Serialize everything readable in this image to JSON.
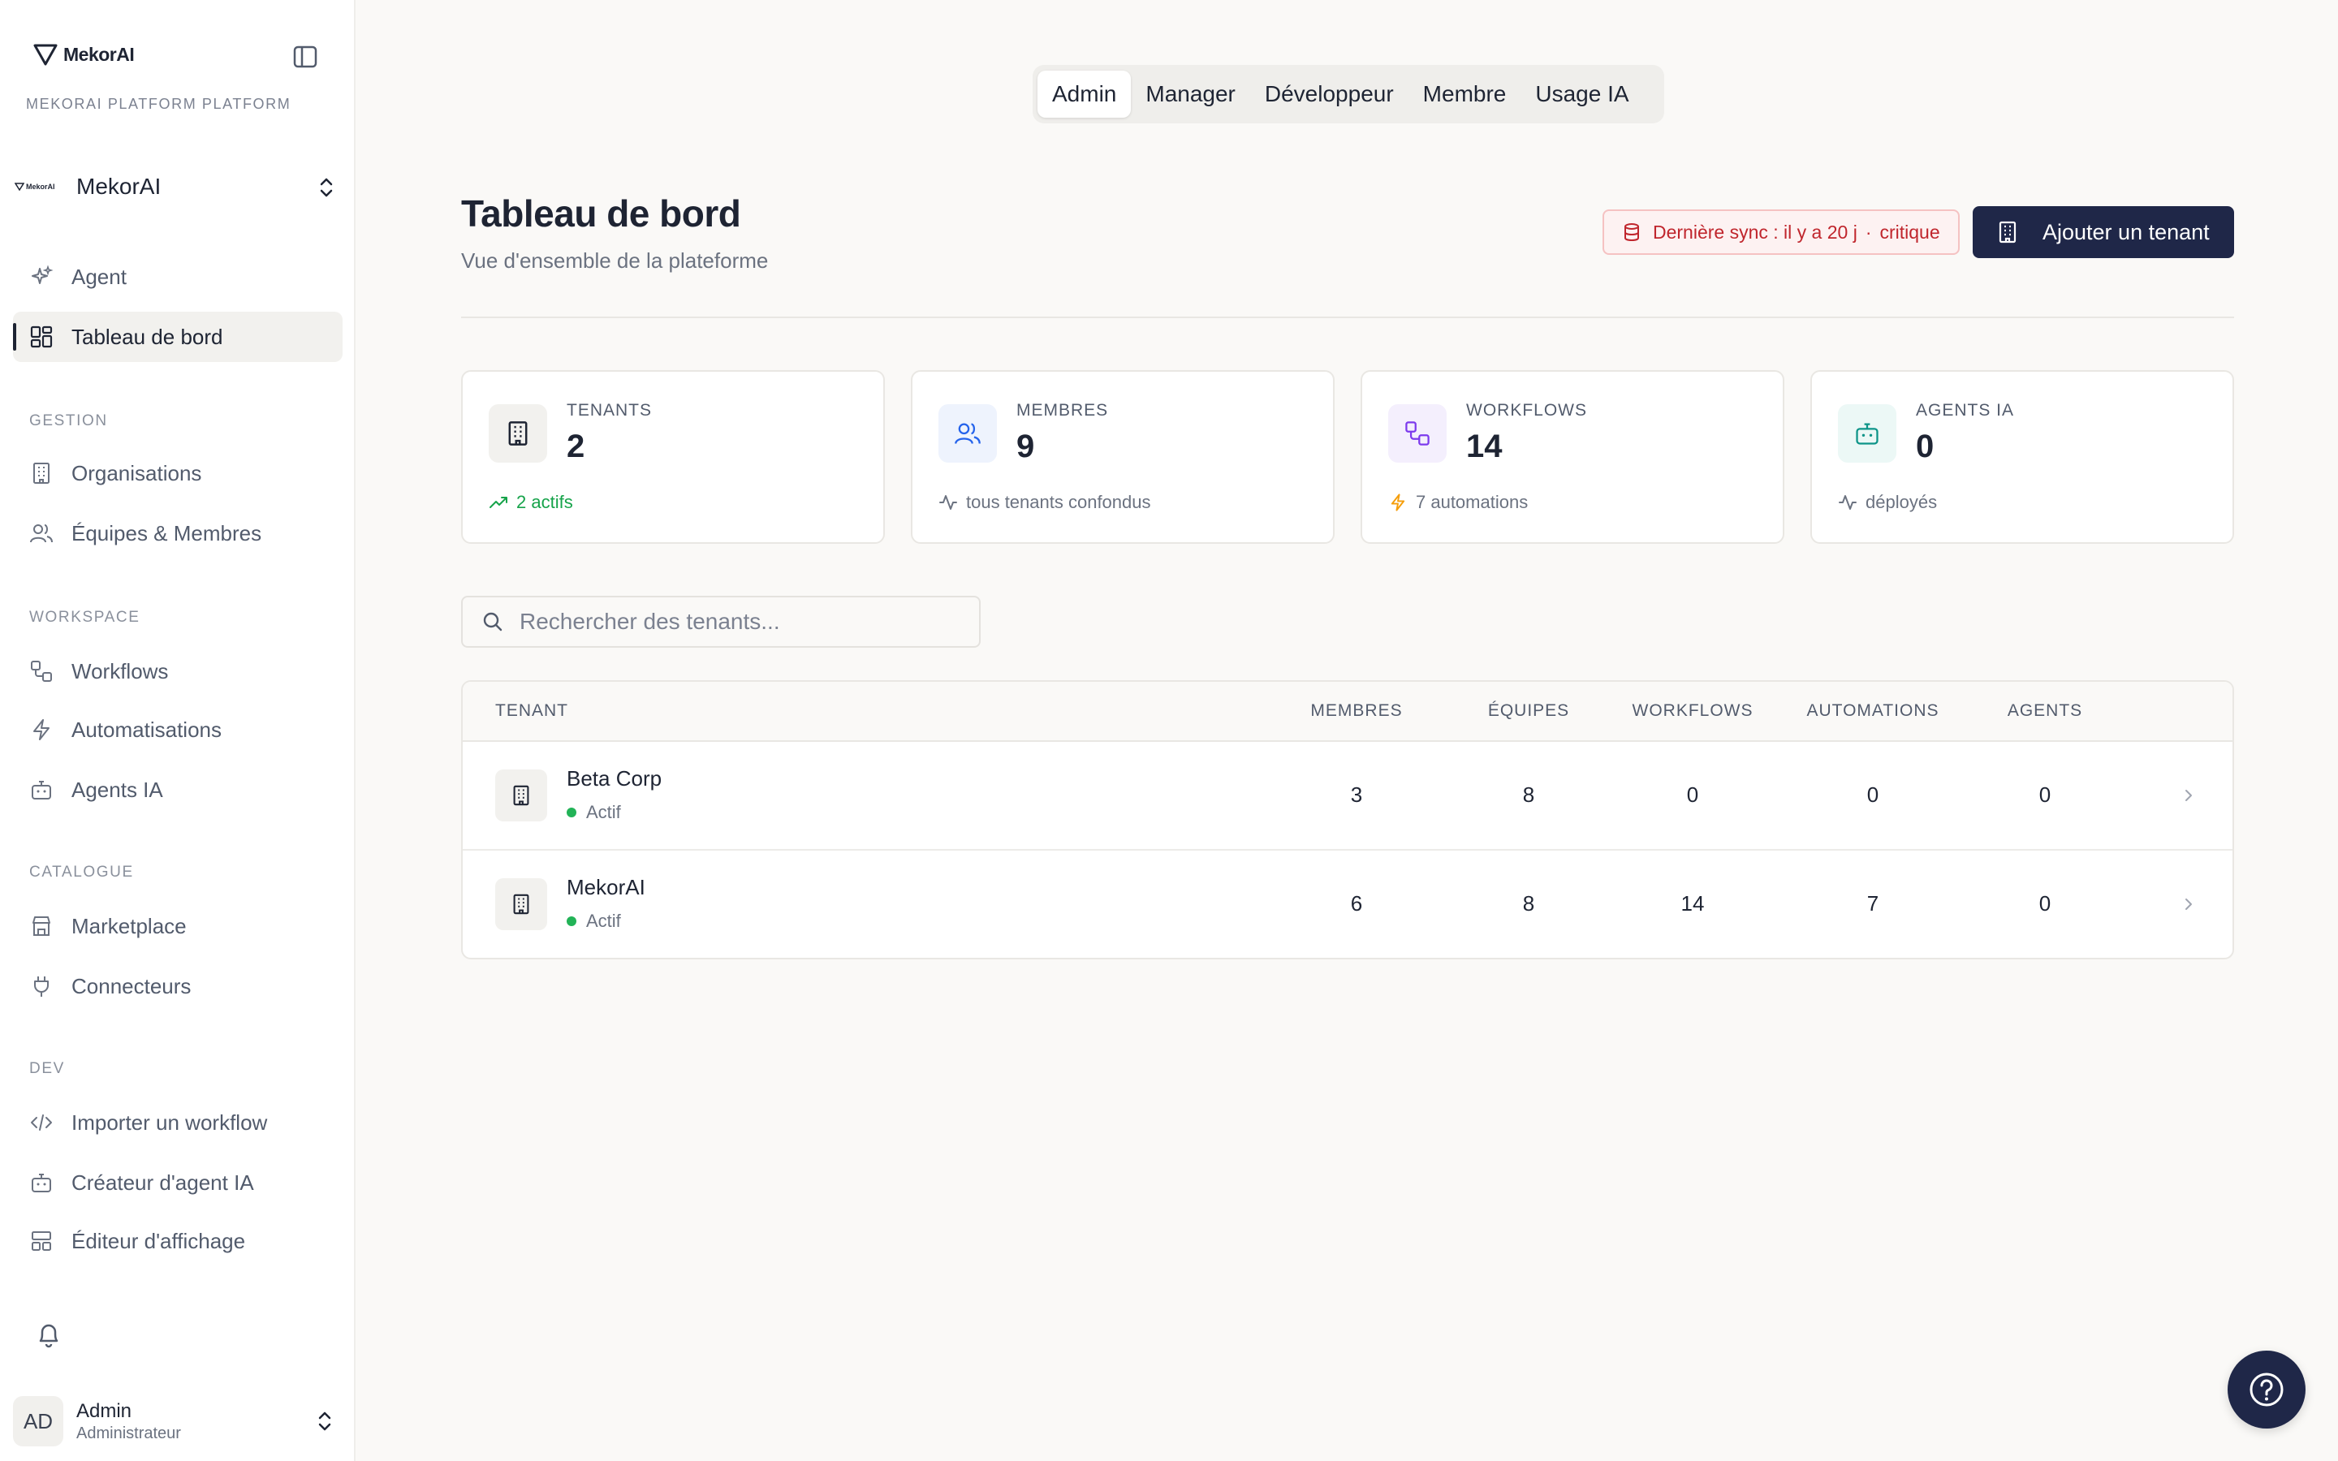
{
  "sidebar": {
    "logo_text": "MekorAI",
    "platform_label": "MEKORAI PLATFORM PLATFORM",
    "org": {
      "logo_text": "MekorAI",
      "name": "MekorAI"
    },
    "primary_items": [
      {
        "label": "Agent",
        "icon": "sparkles-icon"
      },
      {
        "label": "Tableau de bord",
        "icon": "dashboard-icon",
        "active": true
      }
    ],
    "sections": [
      {
        "title": "GESTION",
        "items": [
          {
            "label": "Organisations",
            "icon": "building-icon"
          },
          {
            "label": "Équipes & Membres",
            "icon": "users-icon"
          }
        ]
      },
      {
        "title": "WORKSPACE",
        "items": [
          {
            "label": "Workflows",
            "icon": "workflow-icon"
          },
          {
            "label": "Automatisations",
            "icon": "zap-icon"
          },
          {
            "label": "Agents IA",
            "icon": "bot-icon"
          }
        ]
      },
      {
        "title": "CATALOGUE",
        "items": [
          {
            "label": "Marketplace",
            "icon": "store-icon"
          },
          {
            "label": "Connecteurs",
            "icon": "plug-icon"
          }
        ]
      },
      {
        "title": "DEV",
        "items": [
          {
            "label": "Importer un workflow",
            "icon": "code-icon"
          },
          {
            "label": "Créateur d'agent IA",
            "icon": "bot-icon"
          },
          {
            "label": "Éditeur d'affichage",
            "icon": "layout-icon"
          }
        ]
      }
    ],
    "user": {
      "initials": "AD",
      "name": "Admin",
      "role": "Administrateur"
    }
  },
  "role_tabs": [
    {
      "label": "Admin",
      "active": true
    },
    {
      "label": "Manager"
    },
    {
      "label": "Développeur"
    },
    {
      "label": "Membre"
    },
    {
      "label": "Usage IA"
    }
  ],
  "header": {
    "title": "Tableau de bord",
    "subtitle": "Vue d'ensemble de la plateforme",
    "sync_badge": {
      "text": "Dernière sync : il y a 20 j",
      "severity": "critique"
    },
    "add_button": "Ajouter un tenant"
  },
  "stats": [
    {
      "label": "TENANTS",
      "value": "2",
      "foot": "2 actifs",
      "icon": "building-icon",
      "foot_icon": "trending-up-icon"
    },
    {
      "label": "MEMBRES",
      "value": "9",
      "foot": "tous tenants confondus",
      "icon": "users-icon",
      "foot_icon": "activity-icon"
    },
    {
      "label": "WORKFLOWS",
      "value": "14",
      "foot": "7 automations",
      "icon": "workflow-icon",
      "foot_icon": "zap-icon"
    },
    {
      "label": "AGENTS IA",
      "value": "0",
      "foot": "déployés",
      "icon": "bot-icon",
      "foot_icon": "activity-icon"
    }
  ],
  "search": {
    "placeholder": "Rechercher des tenants..."
  },
  "table": {
    "headers": [
      "TENANT",
      "MEMBRES",
      "ÉQUIPES",
      "WORKFLOWS",
      "AUTOMATIONS",
      "AGENTS"
    ],
    "rows": [
      {
        "name": "Beta Corp",
        "status": "Actif",
        "membres": "3",
        "equipes": "8",
        "workflows": "0",
        "automations": "0",
        "agents": "0"
      },
      {
        "name": "MekorAI",
        "status": "Actif",
        "membres": "6",
        "equipes": "8",
        "workflows": "14",
        "automations": "7",
        "agents": "0"
      }
    ]
  },
  "colors": {
    "primary": "#1f2748",
    "success": "#16a34a",
    "danger": "#c0262d",
    "warning": "#f59e0b",
    "accent_purple": "#7c3aed",
    "accent_blue": "#2563eb",
    "accent_teal": "#0d9488"
  }
}
